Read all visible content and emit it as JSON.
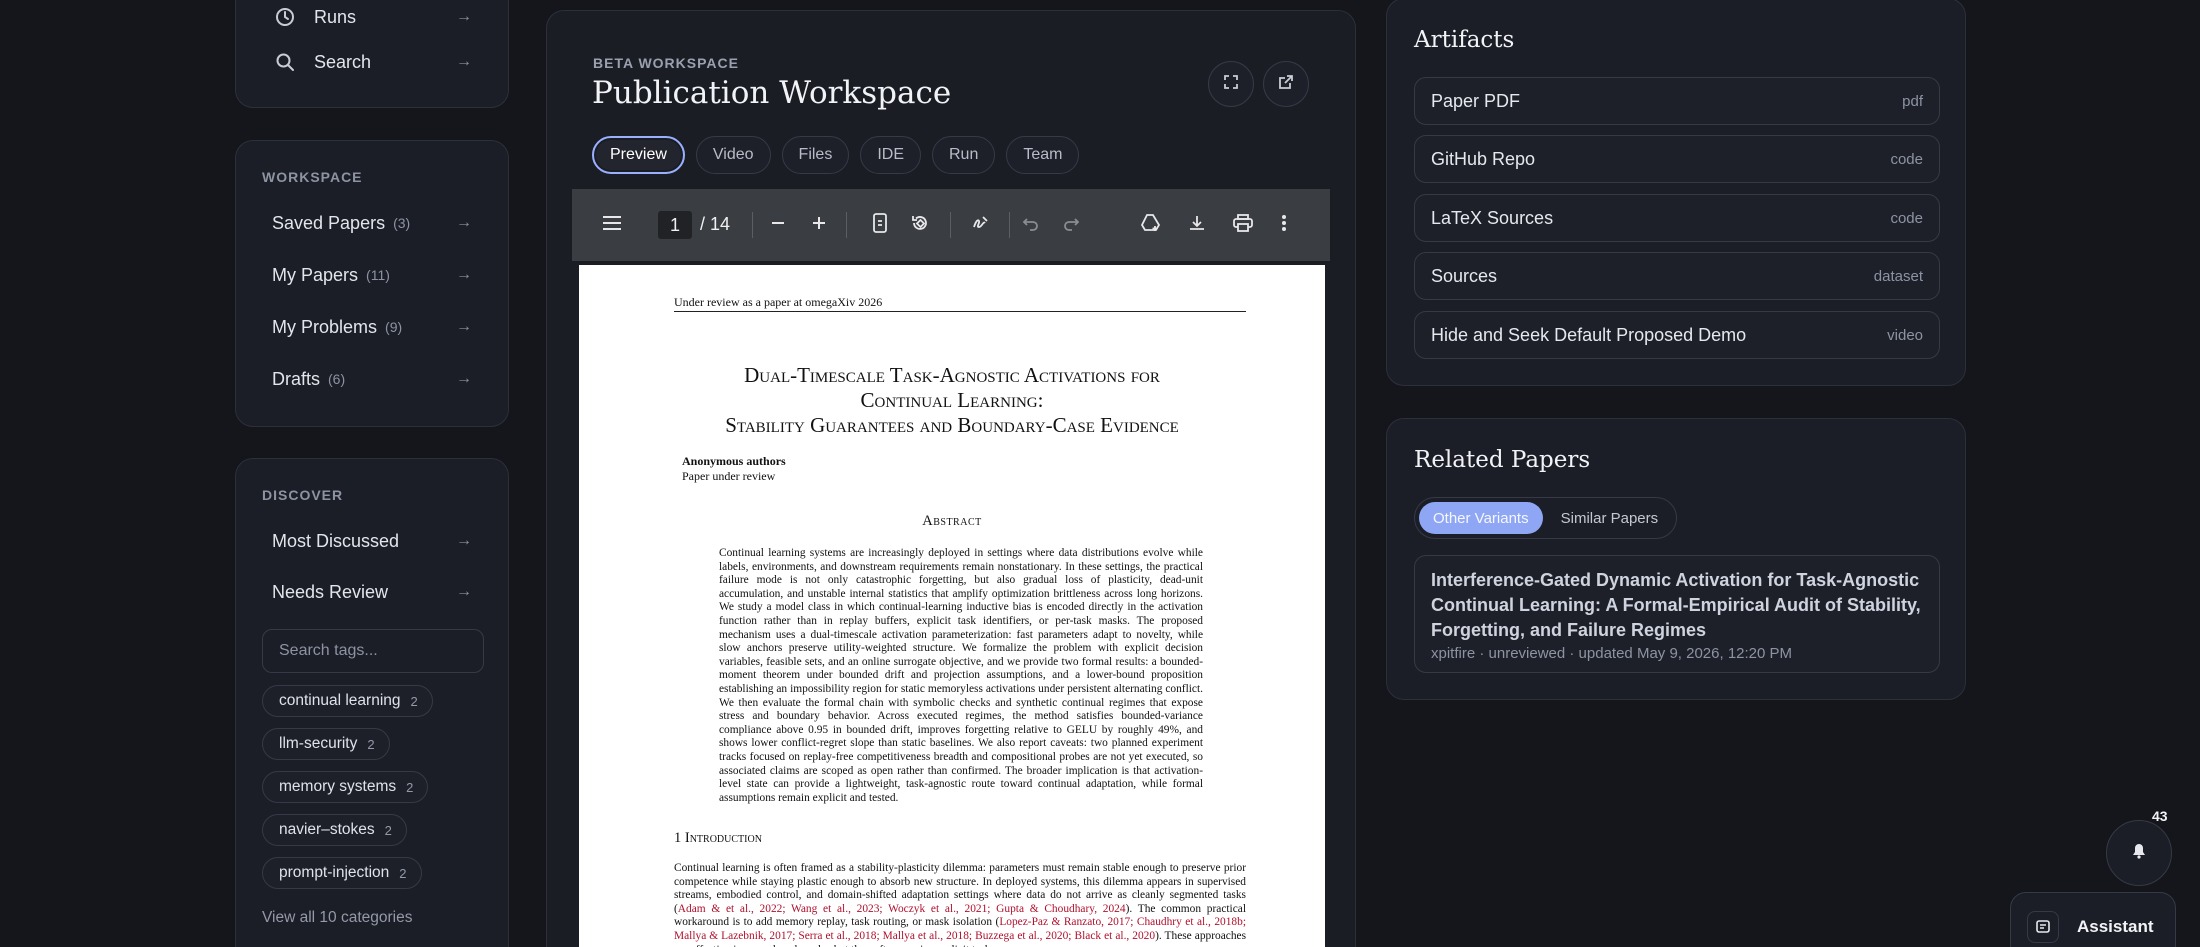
{
  "top_nav": {
    "items": [
      {
        "label": "Runs",
        "icon": "clock-icon"
      },
      {
        "label": "Search",
        "icon": "search-icon"
      }
    ],
    "arrow": "→"
  },
  "workspace_nav": {
    "title": "WORKSPACE",
    "items": [
      {
        "label": "Saved Papers",
        "count": "(3)"
      },
      {
        "label": "My Papers",
        "count": "(11)"
      },
      {
        "label": "My Problems",
        "count": "(9)"
      },
      {
        "label": "Drafts",
        "count": "(6)"
      }
    ]
  },
  "discover_nav": {
    "title": "DISCOVER",
    "items": [
      {
        "label": "Most Discussed"
      },
      {
        "label": "Needs Review"
      }
    ],
    "search_placeholder": "Search tags...",
    "tags": [
      {
        "label": "continual learning",
        "count": "2"
      },
      {
        "label": "llm-security",
        "count": "2"
      },
      {
        "label": "memory systems",
        "count": "2"
      },
      {
        "label": "navier–stokes",
        "count": "2"
      },
      {
        "label": "prompt-injection",
        "count": "2"
      }
    ],
    "view_all": "View all 10 categories"
  },
  "workspace": {
    "kicker": "BETA WORKSPACE",
    "title": "Publication Workspace",
    "tabs": [
      "Preview",
      "Video",
      "Files",
      "IDE",
      "Run",
      "Team"
    ],
    "active_tab": "Preview"
  },
  "pdf_viewer": {
    "current_page": "1",
    "total_pages": "/ 14"
  },
  "paper": {
    "header": "Under review as a paper at omegaXiv 2026",
    "title_line1": "Dual-Timescale Task-Agnostic Activations for",
    "title_line2": "Continual Learning:",
    "title_line3": "Stability Guarantees and Boundary-Case Evidence",
    "authors": "Anonymous authors",
    "affiliation": "Paper under review",
    "abstract_title": "Abstract",
    "abstract": "Continual learning systems are increasingly deployed in settings where data distributions evolve while labels, environments, and downstream requirements remain nonstationary. In these settings, the practical failure mode is not only catastrophic forgetting, but also gradual loss of plasticity, dead-unit accumulation, and unstable internal statistics that amplify optimization brittleness across long horizons. We study a model class in which continual-learning inductive bias is encoded directly in the activation function rather than in replay buffers, explicit task identifiers, or per-task masks. The proposed mechanism uses a dual-timescale activation parameterization: fast parameters adapt to novelty, while slow anchors preserve utility-weighted structure. We formalize the problem with explicit decision variables, feasible sets, and an online surrogate objective, and we provide two formal results: a bounded-moment theorem under bounded drift and projection assumptions, and a lower-bound proposition establishing an impossibility region for static memoryless activations under persistent alternating conflict. We then evaluate the formal chain with symbolic checks and synthetic continual regimes that expose stress and boundary behavior. Across executed regimes, the method satisfies bounded-variance compliance above 0.95 in bounded drift, improves forgetting relative to GELU by roughly 49%, and shows lower conflict-regret slope than static baselines. We also report caveats: two planned experiment tracks focused on replay-free competitiveness breadth and compositional probes are not yet executed, so associated claims are scoped as open rather than confirmed. The broader implication is that activation-level state can provide a lightweight, task-agnostic route toward continual adaptation, while formal assumptions remain explicit and tested.",
    "section_title": "1   Introduction",
    "intro_p1": "Continual learning is often framed as a stability-plasticity dilemma: parameters must remain stable enough to preserve prior competence while staying plastic enough to absorb new structure. In deployed systems, this dilemma appears in supervised streams, embodied control, and domain-shifted adaptation settings where data do not arrive as cleanly segmented tasks (",
    "intro_c1": "Adam & et al., 2022; Wang et al., 2023; Woczyk et al., 2021; Gupta & Choudhary, 2024",
    "intro_p2": "). The common practical workaround is to add memory replay, task routing, or mask isolation (",
    "intro_c2": "Lopez-Paz & Ranzato, 2017; Chaudhry et al., 2018b; Mallya & Lazebnik, 2017; Serra et al., 2018; Mallya et al., 2018; Buzzega et al., 2020; Black et al., 2020",
    "intro_p3": "). These approaches are effective in many benchmarks, but they often require explicit task"
  },
  "artifacts": {
    "title": "Artifacts",
    "items": [
      {
        "label": "Paper PDF",
        "kind": "pdf"
      },
      {
        "label": "GitHub Repo",
        "kind": "code"
      },
      {
        "label": "LaTeX Sources",
        "kind": "code"
      },
      {
        "label": "Sources",
        "kind": "dataset"
      },
      {
        "label": "Hide and Seek Default Proposed Demo",
        "kind": "video"
      }
    ]
  },
  "related": {
    "title": "Related Papers",
    "tabs": [
      "Other Variants",
      "Similar Papers"
    ],
    "active_tab": "Other Variants",
    "card": {
      "title": "Interference-Gated Dynamic Activation for Task-Agnostic Continual Learning: A Formal-Empirical Audit of Stability, Forgetting, and Failure Regimes",
      "meta": "xpitfire · unreviewed · updated May 9, 2026, 12:20 PM"
    }
  },
  "notifications": {
    "count": "43"
  },
  "assistant": {
    "label": "Assistant"
  },
  "colors": {
    "background": "#14161c",
    "panel": "#1b1e26",
    "accent": "#8ea6f3",
    "active_tab_border": "#9ab0ff",
    "citation": "#b0102c"
  }
}
